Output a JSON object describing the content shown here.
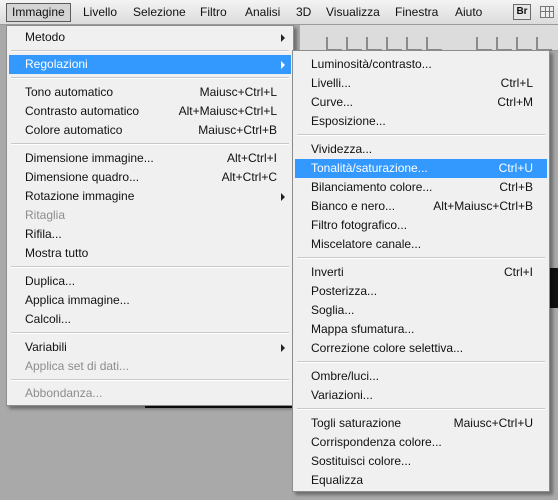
{
  "menubar": {
    "items": [
      "Immagine",
      "Livello",
      "Selezione",
      "Filtro",
      "Analisi",
      "3D",
      "Visualizza",
      "Finestra",
      "Aiuto"
    ],
    "bridge_icon_label": "Br"
  },
  "immagine_menu": {
    "metodo": "Metodo",
    "regolazioni": "Regolazioni",
    "tono_automatico": "Tono automatico",
    "tono_automatico_sc": "Maiusc+Ctrl+L",
    "contrasto_automatico": "Contrasto automatico",
    "contrasto_automatico_sc": "Alt+Maiusc+Ctrl+L",
    "colore_automatico": "Colore automatico",
    "colore_automatico_sc": "Maiusc+Ctrl+B",
    "dimensione_immagine": "Dimensione immagine...",
    "dimensione_immagine_sc": "Alt+Ctrl+I",
    "dimensione_quadro": "Dimensione quadro...",
    "dimensione_quadro_sc": "Alt+Ctrl+C",
    "rotazione_immagine": "Rotazione immagine",
    "ritaglia": "Ritaglia",
    "rifila": "Rifila...",
    "mostra_tutto": "Mostra tutto",
    "duplica": "Duplica...",
    "applica_immagine": "Applica immagine...",
    "calcoli": "Calcoli...",
    "variabili": "Variabili",
    "applica_set": "Applica set di dati...",
    "abbondanza": "Abbondanza..."
  },
  "regolazioni_menu": {
    "luminosita": "Luminosità/contrasto...",
    "livelli": "Livelli...",
    "livelli_sc": "Ctrl+L",
    "curve": "Curve...",
    "curve_sc": "Ctrl+M",
    "esposizione": "Esposizione...",
    "vividezza": "Vividezza...",
    "tonalita": "Tonalità/saturazione...",
    "tonalita_sc": "Ctrl+U",
    "bilanciamento": "Bilanciamento colore...",
    "bilanciamento_sc": "Ctrl+B",
    "bianco_nero": "Bianco e nero...",
    "bianco_nero_sc": "Alt+Maiusc+Ctrl+B",
    "filtro_fotografico": "Filtro fotografico...",
    "miscelatore": "Miscelatore canale...",
    "inverti": "Inverti",
    "inverti_sc": "Ctrl+I",
    "posterizza": "Posterizza...",
    "soglia": "Soglia...",
    "mappa_sfumatura": "Mappa sfumatura...",
    "correzione_selettiva": "Correzione colore selettiva...",
    "ombre_luci": "Ombre/luci...",
    "variazioni": "Variazioni...",
    "togli_saturazione": "Togli saturazione",
    "togli_saturazione_sc": "Maiusc+Ctrl+U",
    "corrispondenza": "Corrispondenza colore...",
    "sostituisci": "Sostituisci colore...",
    "equalizza": "Equalizza"
  },
  "colors": {
    "highlight": "#3399ff",
    "menu_bg": "#f0f0f0",
    "disabled_text": "#8d8d8d"
  }
}
